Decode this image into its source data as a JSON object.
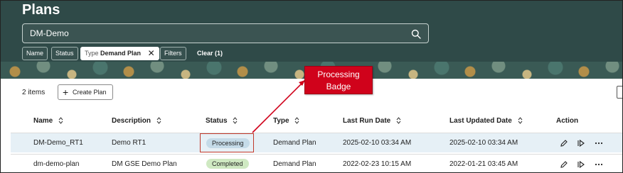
{
  "page": {
    "title": "Plans"
  },
  "search": {
    "value": "DM-Demo"
  },
  "filters": {
    "name_label": "Name",
    "status_label": "Status",
    "type_prefix": "Type",
    "type_value": "Demand Plan",
    "filters_label": "Filters",
    "clear_label": "Clear (1)"
  },
  "annotation": {
    "line1": "Processing",
    "line2": "Badge"
  },
  "toolbar": {
    "items_count": "2 items",
    "create_label": "Create Plan"
  },
  "table": {
    "columns": [
      "Name",
      "Description",
      "Status",
      "Type",
      "Last Run Date",
      "Last Updated Date",
      "Action"
    ],
    "rows": [
      {
        "name": "DM-Demo_RT1",
        "description": "Demo RT1",
        "status": "Processing",
        "type": "Demand Plan",
        "last_run": "2025-02-10 03:34 AM",
        "last_updated": "2025-02-10 03:34 AM"
      },
      {
        "name": "dm-demo-plan",
        "description": "DM GSE Demo Plan",
        "status": "Completed",
        "type": "Demand Plan",
        "last_run": "2022-02-23 10:15 AM",
        "last_updated": "2022-01-21 03:45 AM"
      }
    ]
  },
  "colors": {
    "header_bg": "#2f4a48",
    "callout_bg": "#d0021b",
    "processing_badge": "#c5dbe8",
    "completed_badge": "#cfe9c2",
    "selected_row": "#e6f0f6"
  },
  "icons": {
    "search": "search-icon",
    "close": "close-icon",
    "plus": "plus-icon",
    "sort": "sort-icon",
    "edit": "pencil-icon",
    "run": "run-plan-icon",
    "more": "more-icon"
  }
}
